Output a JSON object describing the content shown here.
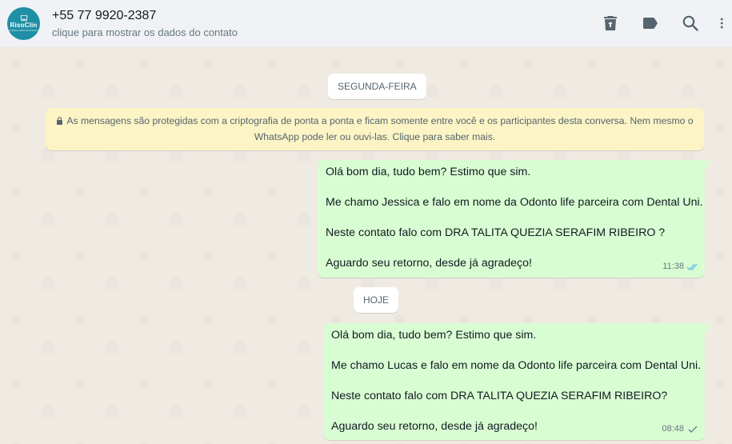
{
  "header": {
    "avatar": {
      "brand": "RisoClin",
      "sub": "CLÍNICA ODONTOLÓGICA"
    },
    "contact_name": "+55 77 9920-2387",
    "contact_sub": "clique para mostrar os dados do contato",
    "icons": [
      "delete-icon",
      "label-icon",
      "search-icon",
      "menu-icon"
    ]
  },
  "chat": {
    "day_chip_1": "SEGUNDA-FEIRA",
    "encryption_notice": "As mensagens são protegidas com a criptografia de ponta a ponta e ficam somente entre você e os participantes desta conversa. Nem mesmo o WhatsApp pode ler ou ouvi-las. Clique para saber mais.",
    "messages": [
      {
        "lines": [
          "Olá bom dia, tudo bem? Estimo que sim.",
          "Me chamo Jessica e falo em nome da Odonto life parceira com Dental Uni.",
          "Neste contato falo com DRA TALITA QUEZIA SERAFIM RIBEIRO ?",
          "Aguardo seu retorno, desde já agradeço!"
        ],
        "time": "11:38",
        "status": "read"
      },
      {
        "lines": [
          "Olá bom dia, tudo bem? Estimo que sim.",
          "Me chamo Lucas e falo em nome da Odonto life parceira com Dental Uni.",
          "Neste contato falo com DRA TALITA QUEZIA SERAFIM RIBEIRO?",
          "Aguardo seu retorno, desde já agradeço!"
        ],
        "time": "08:48",
        "status": "sent"
      }
    ],
    "day_chip_2": "HOJE"
  },
  "colors": {
    "header_bg": "#f0f2f5",
    "chat_bg": "#efeae2",
    "outgoing_bubble": "#d9fdd3",
    "encryption_bg": "#fdf4c5",
    "read_tick": "#53bdeb",
    "sent_tick": "#667781"
  }
}
